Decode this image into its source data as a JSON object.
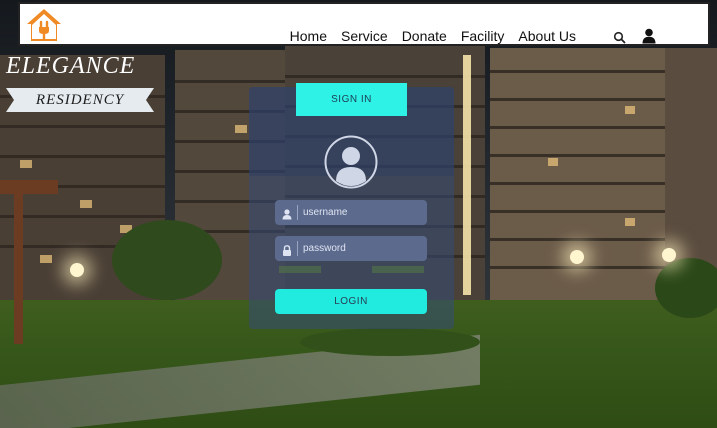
{
  "nav": {
    "logo": "home-icon",
    "links": [
      "Home",
      "Service",
      "Donate",
      "Facility",
      "About Us"
    ],
    "search_icon": "search-icon",
    "user_icon": "user-icon"
  },
  "brand": {
    "title": "ELEGANCE",
    "subtitle": "RESIDENCY"
  },
  "login": {
    "tab_label": "SIGN IN",
    "avatar_icon": "user-avatar-icon",
    "username_placeholder": "username",
    "password_placeholder": "password",
    "button_label": "LOGIN"
  },
  "colors": {
    "accent": "#2ef2e6",
    "logo": "#f08a25",
    "card": "#344a76"
  }
}
